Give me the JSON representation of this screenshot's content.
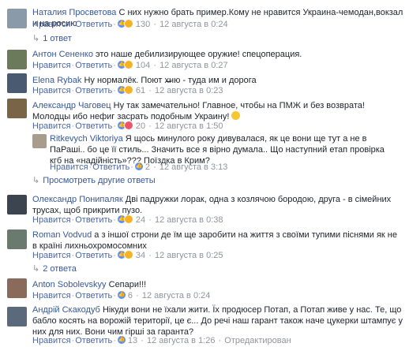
{
  "comments": [
    {
      "author": "Наталия Просветова",
      "text": "С них нужно брать пример.Кому не нравится Украина-чемодан,вокзал и на росию",
      "like": "Нравится",
      "reply": "Ответить",
      "reactions": "130",
      "date": "12 августа в 0:24",
      "avatar_color": "#8a9aa8"
    },
    {
      "author": "Антон Сененко",
      "text": "это наше дебилизирующее оружие! спецоперация.",
      "like": "Нравится",
      "reply": "Ответить",
      "reactions": "104",
      "date": "12 августа в 0:27",
      "avatar_color": "#6b7a5a"
    },
    {
      "author": "Elena Rybak",
      "text": "Ну нормалёк. Поют х̶̶̶̶̶ню - туда им и дорога",
      "like": "Нравится",
      "reply": "Ответить",
      "reactions": "61",
      "date": "12 августа в 0:23",
      "avatar_color": "#4a5a70"
    },
    {
      "author": "Александр Чаговец",
      "text": "Ну так замечательно! Главное, чтобы на ПМЖ и без возврата! Молодцы ибо нефиг засрать подобным Украину!",
      "like": "Нравится",
      "reply": "Ответить",
      "reactions": "20",
      "date": "12 августа в 1:50",
      "avatar_color": "#7a6448"
    },
    {
      "author": "Ritkevych Viktoriya",
      "text": "Я щось минулого року дивувалася, як це вони ще тут а не в ПаРаші.. бо це її стиль... Значить все я вірно думала.. Що наступний етап провірка кгб на «надійність»??? Поїздка в Крим?",
      "like": "Нравится",
      "reply": "Ответить",
      "reactions": "2",
      "date": "12 августа в 3:13",
      "avatar_color": "#a89c8c"
    },
    {
      "author": "Олександр Понипаляк",
      "text": "Дві падружки лорак, одна з козлячою бородою, друга - в сімейних трусах, щоб прикрити пузо.",
      "like": "Нравится",
      "reply": "Ответить",
      "reactions": "24",
      "date": "12 августа в 0:38",
      "avatar_color": "#3c4450"
    },
    {
      "author": "Roman Vodvud",
      "text": "а з іншої строни де їм ще заробити на життя з своїми тупими піснями як не в країні лихньохромосомних",
      "like": "Нравится",
      "reply": "Ответить",
      "reactions": "34",
      "date": "12 августа в 0:25",
      "avatar_color": "#6a7a6e"
    },
    {
      "author": "Anton Sobolevskyy",
      "text": "Сепари!!!",
      "like": "Нравится",
      "reply": "Ответить",
      "reactions": "6",
      "date": "12 августа в 0:24",
      "avatar_color": "#8a6a5a"
    },
    {
      "author": "Андрій Скакодуб",
      "text": "Нікуди вони не їхали жити. Їх продюсер Потап, а Потап живе у нас. Те, що бабло косять на ворожій території, це є... До речі наш гарант також наче цукерки штампує у них для них. Вони чим гірші за гаранта?",
      "like": "Нравится",
      "reply": "Ответить",
      "reactions": "13",
      "date": "12 августа в 1:26",
      "edited": "Отредактирован",
      "avatar_color": "#5a6a7a"
    }
  ],
  "replies_links": {
    "one_reply": "1 ответ",
    "other_replies": "Просмотреть другие ответы",
    "two_replies": "2 ответа"
  }
}
